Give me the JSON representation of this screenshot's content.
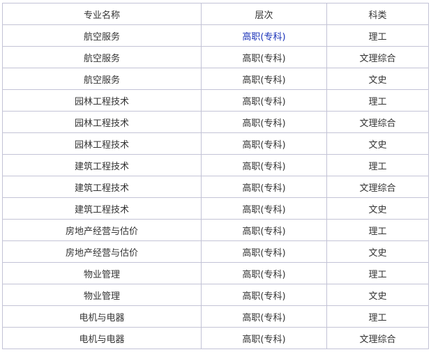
{
  "table": {
    "headers": [
      "专业名称",
      "层次",
      "科类"
    ],
    "rows": [
      [
        "航空服务",
        "高职(专科)",
        "理工"
      ],
      [
        "航空服务",
        "高职(专科)",
        "文理综合"
      ],
      [
        "航空服务",
        "高职(专科)",
        "文史"
      ],
      [
        "园林工程技术",
        "高职(专科)",
        "理工"
      ],
      [
        "园林工程技术",
        "高职(专科)",
        "文理综合"
      ],
      [
        "园林工程技术",
        "高职(专科)",
        "文史"
      ],
      [
        "建筑工程技术",
        "高职(专科)",
        "理工"
      ],
      [
        "建筑工程技术",
        "高职(专科)",
        "文理综合"
      ],
      [
        "建筑工程技术",
        "高职(专科)",
        "文史"
      ],
      [
        "房地产经营与估价",
        "高职(专科)",
        "理工"
      ],
      [
        "房地产经营与估价",
        "高职(专科)",
        "文史"
      ],
      [
        "物业管理",
        "高职(专科)",
        "理工"
      ],
      [
        "物业管理",
        "高职(专科)",
        "文史"
      ],
      [
        "电机与电器",
        "高职(专科)",
        "理工"
      ],
      [
        "电机与电器",
        "高职(专科)",
        "文理综合"
      ]
    ],
    "link_color": "#1a32b8",
    "text_color": "#333333",
    "border_color": "#c3c3d6"
  }
}
